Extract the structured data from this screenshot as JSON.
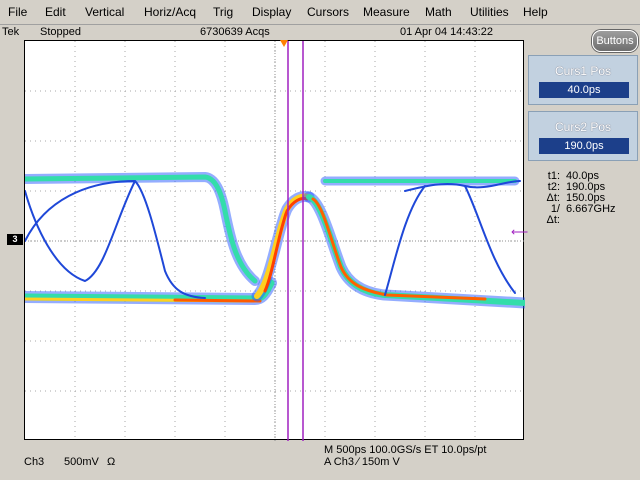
{
  "menu": [
    "File",
    "Edit",
    "Vertical",
    "Horiz/Acq",
    "Trig",
    "Display",
    "Cursors",
    "Measure",
    "Math",
    "Utilities",
    "Help"
  ],
  "status": {
    "brand": "Tek",
    "state": "Stopped",
    "acqs": "6730639 Acqs",
    "datetime": "01 Apr 04 14:43:22"
  },
  "buttons_label": "Buttons",
  "cursor1": {
    "title": "Curs1 Pos",
    "value": "40.0ps"
  },
  "cursor2": {
    "title": "Curs2 Pos",
    "value": "190.0ps"
  },
  "readout": [
    {
      "key": "t1:",
      "value": "40.0ps"
    },
    {
      "key": "t2:",
      "value": "190.0ps"
    },
    {
      "key": "Δt:",
      "value": "150.0ps"
    },
    {
      "key": "1/Δt:",
      "value": "6.667GHz"
    }
  ],
  "channel": {
    "name": "Ch3",
    "scale": "500mV",
    "impedance": "Ω"
  },
  "timebase": "M 500ps 100.0GS/s ET 10.0ps/pt",
  "trigger": "A  Ch3  ∕  150m   V",
  "channel_marker": "3",
  "colors": {
    "cursor": "#a020c0",
    "trigger": "#ff8000",
    "brand_blue": "#1c3f8a"
  }
}
